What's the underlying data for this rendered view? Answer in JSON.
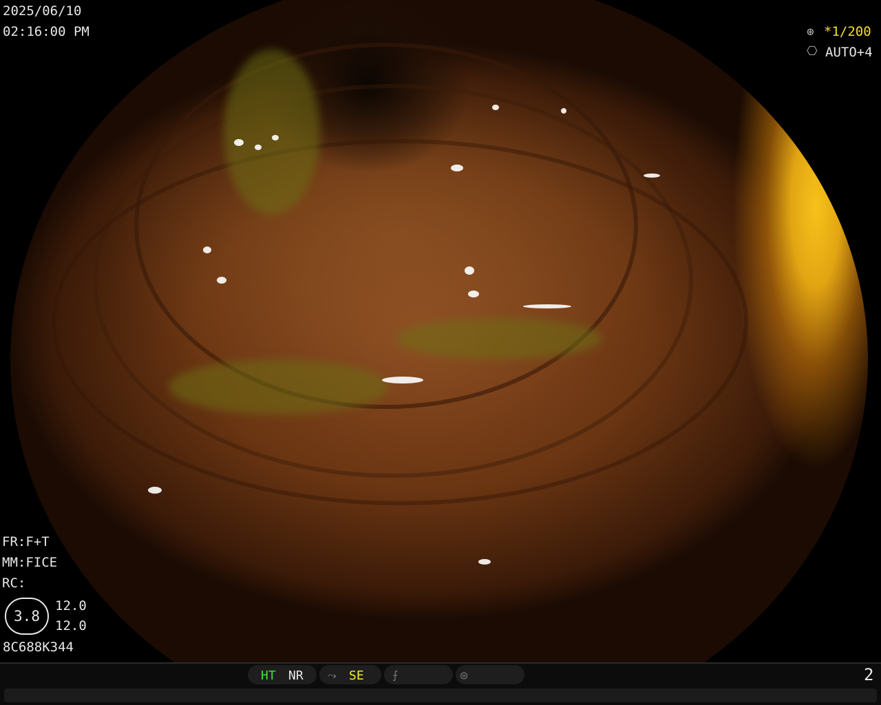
{
  "overlay": {
    "date": "2025/06/10",
    "time": "02:16:00  PM",
    "shutter": "*1/200",
    "iris": "AUTO+4",
    "fr": "FR:F+T",
    "mm": "MM:FICE",
    "rc": "RC:",
    "circle_value": "3.8",
    "value_top": "12.0",
    "value_bottom": "12.0",
    "serial": "8C688K344"
  },
  "status_bar": {
    "ht": "HT",
    "nr": "NR",
    "se": "SE",
    "page_number": "2"
  },
  "colors": {
    "ht": "#37e43a",
    "se": "#f2f222",
    "shutter_star": "#f2e020",
    "overlay_text": "#e8e8e8"
  },
  "icons": [
    "shutter-icon",
    "iris-icon",
    "structure-enhance-icon",
    "flat-curve-icon",
    "gauge-icon"
  ]
}
